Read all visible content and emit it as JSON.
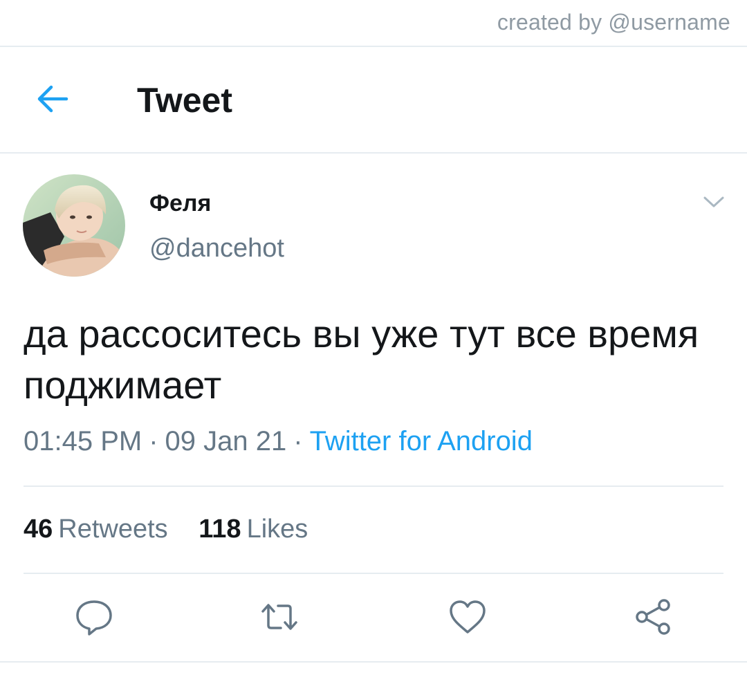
{
  "watermark": "created by @username",
  "header": {
    "back_icon": "arrow-left-icon",
    "title": "Tweet"
  },
  "tweet": {
    "author": {
      "display_name": "Феля",
      "handle": "@dancehot",
      "avatar": "avatar-photo"
    },
    "menu_icon": "chevron-down-icon",
    "text": "да рассоситесь вы уже тут все время поджимает",
    "time": "01:45 PM",
    "date": "09 Jan 21",
    "separator": "·",
    "source": "Twitter for Android",
    "stats": {
      "retweets_count": "46",
      "retweets_label": "Retweets",
      "likes_count": "118",
      "likes_label": "Likes"
    },
    "actions": [
      {
        "icon": "reply-icon"
      },
      {
        "icon": "retweet-icon"
      },
      {
        "icon": "heart-icon"
      },
      {
        "icon": "share-icon"
      }
    ]
  },
  "colors": {
    "accent": "#1da1f2",
    "text_primary": "#14171a",
    "text_secondary": "#657786",
    "divider": "#e6ecf0"
  }
}
